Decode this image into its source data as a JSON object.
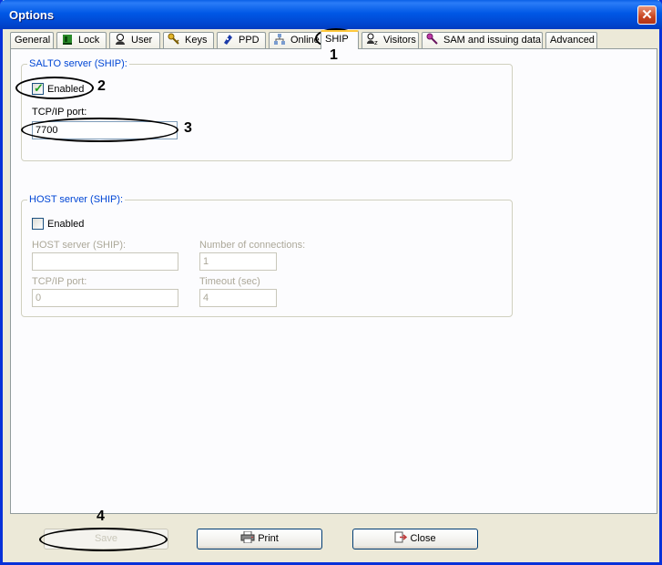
{
  "window": {
    "title": "Options",
    "close_glyph": "✕"
  },
  "tabs": [
    {
      "label": "General",
      "icon": ""
    },
    {
      "label": "Lock",
      "icon": "lock-icon"
    },
    {
      "label": "User",
      "icon": "user-icon"
    },
    {
      "label": "Keys",
      "icon": "keys-icon"
    },
    {
      "label": "PPD",
      "icon": "ppd-icon"
    },
    {
      "label": "Online",
      "icon": "online-icon"
    },
    {
      "label": "SHIP",
      "icon": ""
    },
    {
      "label": "Visitors",
      "icon": "visitors-icon"
    },
    {
      "label": "SAM and issuing data",
      "icon": "sam-key-icon"
    },
    {
      "label": "Advanced",
      "icon": ""
    }
  ],
  "active_tab": "SHIP",
  "salto_group": {
    "title": "SALTO server (SHIP):",
    "enabled_label": "Enabled",
    "enabled_checked": true,
    "port_label": "TCP/IP port:",
    "port_value": "7700"
  },
  "host_group": {
    "title": "HOST server (SHIP):",
    "enabled_label": "Enabled",
    "enabled_checked": false,
    "server_label": "HOST server (SHIP):",
    "server_value": "",
    "connections_label": "Number of connections:",
    "connections_value": "1",
    "port_label": "TCP/IP port:",
    "port_value": "0",
    "timeout_label": "Timeout (sec)",
    "timeout_value": "4"
  },
  "buttons": {
    "save": "Save",
    "print": "Print",
    "close": "Close"
  },
  "callouts": [
    "1",
    "2",
    "3",
    "4"
  ]
}
